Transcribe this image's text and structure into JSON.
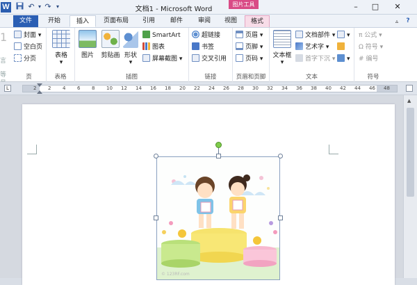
{
  "app": {
    "title": "文档1 - Microsoft Word",
    "context_tab_banner": "图片工具",
    "logo_letter": "W",
    "accent": "#2b5fb4",
    "context_color": "#d94b86"
  },
  "quick_access": {
    "save_icon": "save-icon",
    "undo_icon": "undo-icon",
    "redo_icon": "redo-icon",
    "customize_icon": "customize-icon"
  },
  "window_controls": {
    "minimize": "–",
    "maximize": "□",
    "close": "✕"
  },
  "tabs": [
    {
      "label": "文件"
    },
    {
      "label": "开始"
    },
    {
      "label": "插入"
    },
    {
      "label": "页面布局"
    },
    {
      "label": "引用"
    },
    {
      "label": "邮件"
    },
    {
      "label": "审阅"
    },
    {
      "label": "视图"
    },
    {
      "label": "格式"
    }
  ],
  "ribbon": {
    "pages": {
      "label": "页",
      "items": [
        "封面",
        "空白页",
        "分页"
      ]
    },
    "tables": {
      "label": "表格",
      "button": "表格"
    },
    "illustrations": {
      "label": "插图",
      "picture": "图片",
      "clipart": "剪贴画",
      "shapes": "形状",
      "smartart": "SmartArt",
      "chart": "图表",
      "screenshot": "屏幕截图"
    },
    "links": {
      "label": "链接",
      "items": [
        "超链接",
        "书签",
        "交叉引用"
      ]
    },
    "header_footer": {
      "label": "页眉和页脚",
      "items": [
        "页眉",
        "页脚",
        "页码"
      ]
    },
    "text": {
      "label": "文本",
      "textbox": "文本框",
      "items": [
        "文档部件",
        "艺术字",
        "首字下沉"
      ]
    },
    "symbols": {
      "label": "符号",
      "items": [
        "公式",
        "符号",
        "编号"
      ]
    }
  },
  "ruler": {
    "numbers": [
      "2",
      "2",
      "4",
      "6",
      "8",
      "10",
      "12",
      "14",
      "16",
      "18",
      "20",
      "22",
      "24",
      "26",
      "28",
      "30",
      "32",
      "34",
      "36",
      "38",
      "40",
      "42",
      "44",
      "46",
      "48"
    ]
  },
  "picture": {
    "description_icon": "children-on-podium-illustration",
    "watermark": "© 123RF.com"
  },
  "left_edge": {
    "glyphs": [
      "1",
      "言",
      "等",
      "号",
      "资"
    ]
  }
}
